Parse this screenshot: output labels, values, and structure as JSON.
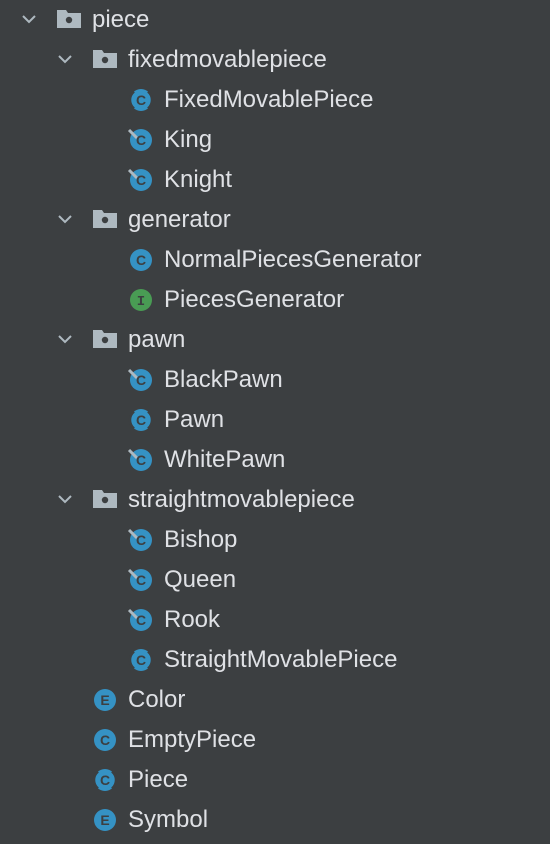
{
  "tree": {
    "root": {
      "label": "piece",
      "icon": "package-icon"
    },
    "fixedmovablepiece": {
      "label": "fixedmovablepiece",
      "icon": "package-icon",
      "children": [
        {
          "label": "FixedMovablePiece",
          "icon": "abstract-class-icon"
        },
        {
          "label": "King",
          "icon": "class-icon"
        },
        {
          "label": "Knight",
          "icon": "class-icon"
        }
      ]
    },
    "generator": {
      "label": "generator",
      "icon": "package-icon",
      "children": [
        {
          "label": "NormalPiecesGenerator",
          "icon": "class-icon"
        },
        {
          "label": "PiecesGenerator",
          "icon": "interface-icon"
        }
      ]
    },
    "pawn": {
      "label": "pawn",
      "icon": "package-icon",
      "children": [
        {
          "label": "BlackPawn",
          "icon": "class-icon"
        },
        {
          "label": "Pawn",
          "icon": "abstract-class-icon"
        },
        {
          "label": "WhitePawn",
          "icon": "class-icon"
        }
      ]
    },
    "straightmovablepiece": {
      "label": "straightmovablepiece",
      "icon": "package-icon",
      "children": [
        {
          "label": "Bishop",
          "icon": "class-icon"
        },
        {
          "label": "Queen",
          "icon": "class-icon"
        },
        {
          "label": "Rook",
          "icon": "class-icon"
        },
        {
          "label": "StraightMovablePiece",
          "icon": "abstract-class-icon"
        }
      ]
    },
    "files": [
      {
        "label": "Color",
        "icon": "enum-icon"
      },
      {
        "label": "EmptyPiece",
        "icon": "class-icon"
      },
      {
        "label": "Piece",
        "icon": "abstract-class-icon"
      },
      {
        "label": "Symbol",
        "icon": "enum-icon"
      }
    ]
  },
  "colors": {
    "background": "#3c3f41",
    "text": "#dfe1e5",
    "class_icon": "#3592c4",
    "interface_icon": "#499c54",
    "folder_icon": "#aeb9c0"
  }
}
